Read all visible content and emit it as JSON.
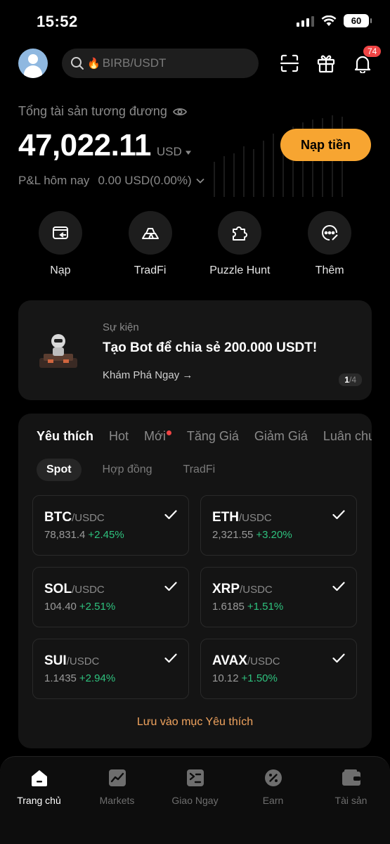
{
  "status_bar": {
    "time": "15:52",
    "battery": "60"
  },
  "header": {
    "search_placeholder": "BIRB/USDT",
    "notification_count": "74",
    "icons": [
      "avatar",
      "search-icon",
      "scan-icon",
      "gift-icon",
      "bell-icon"
    ]
  },
  "assets": {
    "label": "Tổng tài sản tương đương",
    "value": "47,022.11",
    "currency": "USD",
    "pnl_label": "P&L hôm nay",
    "pnl_value": "0.00 USD(0.00%)",
    "deposit_button": "Nạp tiền"
  },
  "quick_actions": [
    {
      "label": "Nạp",
      "icon": "wallet-in-icon"
    },
    {
      "label": "TradFi",
      "icon": "gold-bars-icon"
    },
    {
      "label": "Puzzle Hunt",
      "icon": "puzzle-icon"
    },
    {
      "label": "Thêm",
      "icon": "more-icon"
    }
  ],
  "event": {
    "tag": "Sự kiện",
    "title": "Tạo Bot để chia sẻ 200.000 USDT!",
    "link": "Khám Phá Ngay →",
    "page_current": "1",
    "page_total": "/4"
  },
  "market": {
    "tabs": [
      "Yêu thích",
      "Hot",
      "Mới",
      "Tăng Giá",
      "Giảm Giá",
      "Luân chuyển"
    ],
    "subtabs": [
      "Spot",
      "Hợp đồng",
      "TradFi"
    ],
    "pairs": [
      {
        "base": "BTC",
        "quote": "/USDC",
        "price": "78,831.4",
        "change": "+2.45%"
      },
      {
        "base": "ETH",
        "quote": "/USDC",
        "price": "2,321.55",
        "change": "+3.20%"
      },
      {
        "base": "SOL",
        "quote": "/USDC",
        "price": "104.40",
        "change": "+2.51%"
      },
      {
        "base": "XRP",
        "quote": "/USDC",
        "price": "1.6185",
        "change": "+1.51%"
      },
      {
        "base": "SUI",
        "quote": "/USDC",
        "price": "1.1435",
        "change": "+2.94%"
      },
      {
        "base": "AVAX",
        "quote": "/USDC",
        "price": "10.12",
        "change": "+1.50%"
      }
    ],
    "save_label": "Lưu vào mục Yêu thích"
  },
  "bottom_nav": [
    {
      "label": "Trang chủ",
      "icon": "home-icon",
      "active": true
    },
    {
      "label": "Markets",
      "icon": "markets-icon"
    },
    {
      "label": "Giao Ngay",
      "icon": "spot-trade-icon"
    },
    {
      "label": "Earn",
      "icon": "earn-icon"
    },
    {
      "label": "Tài sản",
      "icon": "assets-wallet-icon"
    }
  ],
  "colors": {
    "accent": "#f7a531",
    "positive": "#2ec27e",
    "badge": "#ef4444",
    "link_orange": "#f0a35e"
  }
}
